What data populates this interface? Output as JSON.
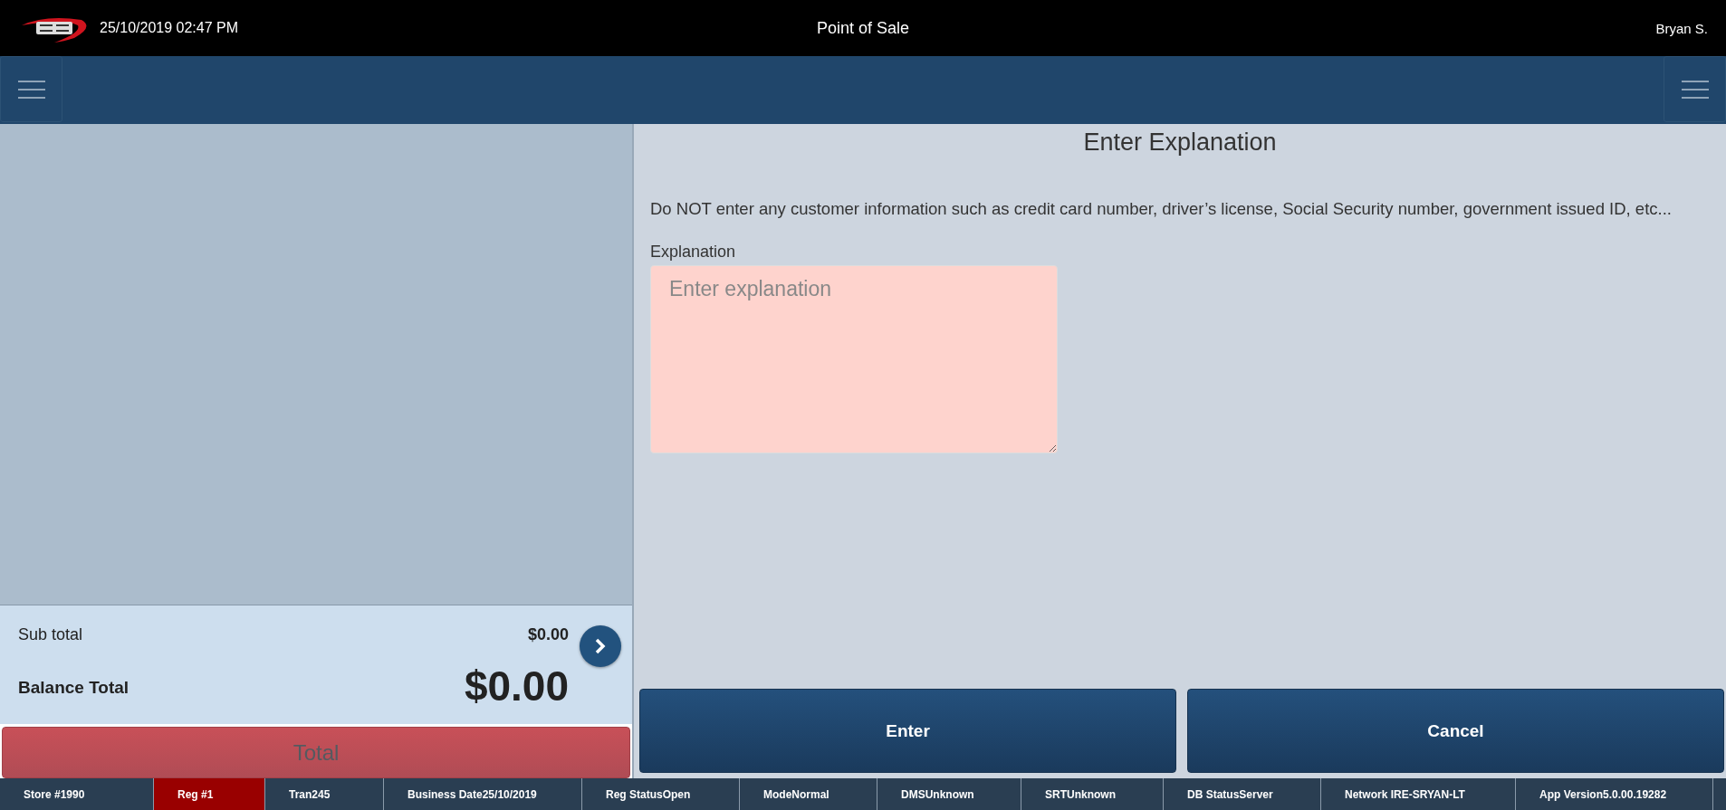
{
  "header": {
    "datetime": "25/10/2019 02:47 PM",
    "title": "Point of Sale",
    "user": "Bryan S."
  },
  "summary": {
    "subtotal_label": "Sub total",
    "subtotal": "$0.00",
    "balance_label": "Balance Total",
    "balance": "$0.00"
  },
  "total_button": {
    "label": "Total",
    "disabled": true
  },
  "dialog": {
    "title": "Enter Explanation",
    "notice": "Do NOT enter any customer information such as credit card number, driver’s license, Social Security number, government issued ID, etc...",
    "field_label": "Explanation",
    "placeholder": "Enter explanation",
    "invalid": true
  },
  "buttons": [
    "Enter",
    "Cancel"
  ],
  "status_bar": [
    {
      "text": "Store #1990",
      "highlighted": false
    },
    {
      "text": "Reg #1",
      "highlighted": true
    },
    {
      "text": "Tran245",
      "highlighted": false
    },
    {
      "text": "Business Date25/10/2019",
      "highlighted": false
    },
    {
      "text": "Reg StatusOpen",
      "highlighted": false
    },
    {
      "text": "ModeNormal",
      "highlighted": false
    },
    {
      "text": "DMSUnknown",
      "highlighted": false
    },
    {
      "text": "SRTUnknown",
      "highlighted": false
    },
    {
      "text": "DB StatusServer",
      "highlighted": false
    },
    {
      "text": "Network IRE-SRYAN-LT",
      "highlighted": false
    },
    {
      "text": "App Version5.0.00.19282",
      "highlighted": false
    }
  ]
}
